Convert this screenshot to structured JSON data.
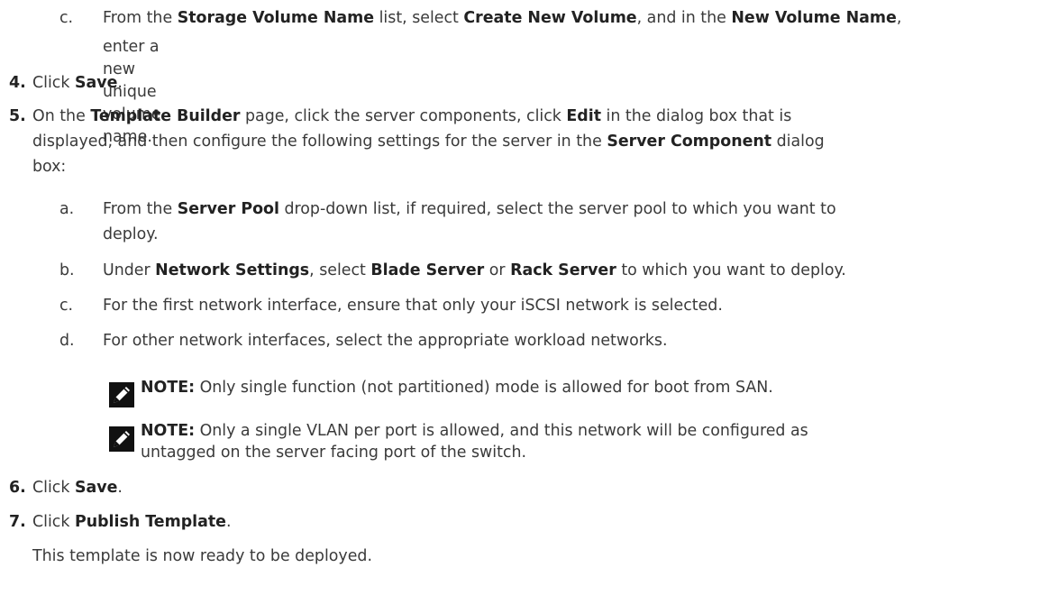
{
  "step3c": {
    "letter": "c.",
    "line1": [
      {
        "t": "From the ",
        "b": false
      },
      {
        "t": "Storage Volume Name",
        "b": true
      },
      {
        "t": " list, select ",
        "b": false
      },
      {
        "t": "Create New Volume",
        "b": true
      },
      {
        "t": ", and in the ",
        "b": false
      },
      {
        "t": "New Volume Name",
        "b": true
      },
      {
        "t": ",",
        "b": false
      }
    ],
    "line2": "enter a new unique volume name."
  },
  "step4": {
    "number": "4.",
    "parts": [
      {
        "t": "Click ",
        "b": false
      },
      {
        "t": "Save",
        "b": true
      },
      {
        "t": ".",
        "b": false
      }
    ]
  },
  "step5": {
    "number": "5.",
    "line1": [
      {
        "t": "On the ",
        "b": false
      },
      {
        "t": "Template Builder",
        "b": true
      },
      {
        "t": " page, click the server components, click ",
        "b": false
      },
      {
        "t": "Edit",
        "b": true
      },
      {
        "t": " in the dialog box that is",
        "b": false
      }
    ],
    "line2": [
      {
        "t": "displayed, and then configure the following settings for the server in the ",
        "b": false
      },
      {
        "t": "Server Component",
        "b": true
      },
      {
        "t": " dialog",
        "b": false
      }
    ],
    "line3": "box:"
  },
  "step5a": {
    "letter": "a.",
    "line1": [
      {
        "t": "From the ",
        "b": false
      },
      {
        "t": "Server Pool",
        "b": true
      },
      {
        "t": " drop-down list, if required, select the server pool to which you want to",
        "b": false
      }
    ],
    "line2": "deploy."
  },
  "step5b": {
    "letter": "b.",
    "line1": [
      {
        "t": "Under ",
        "b": false
      },
      {
        "t": "Network Settings",
        "b": true
      },
      {
        "t": ", select ",
        "b": false
      },
      {
        "t": "Blade Server",
        "b": true
      },
      {
        "t": " or ",
        "b": false
      },
      {
        "t": "Rack Server",
        "b": true
      },
      {
        "t": " to which you want to deploy.",
        "b": false
      }
    ]
  },
  "step5c": {
    "letter": "c.",
    "text": "For the first network interface, ensure that only your iSCSI network is selected."
  },
  "step5d": {
    "letter": "d.",
    "text": "For other network interfaces, select the appropriate workload networks."
  },
  "note1": {
    "icon": "pencil-note-icon",
    "label": "NOTE:",
    "text": " Only single function (not partitioned) mode is allowed for boot from SAN."
  },
  "note2": {
    "icon": "pencil-note-icon",
    "label": "NOTE:",
    "line1": " Only a single VLAN per port is allowed, and this network will be configured as",
    "line2": "untagged on the server facing port of the switch."
  },
  "step6": {
    "number": "6.",
    "parts": [
      {
        "t": "Click ",
        "b": false
      },
      {
        "t": "Save",
        "b": true
      },
      {
        "t": ".",
        "b": false
      }
    ]
  },
  "step7": {
    "number": "7.",
    "parts": [
      {
        "t": "Click ",
        "b": false
      },
      {
        "t": "Publish Template",
        "b": true
      },
      {
        "t": ".",
        "b": false
      }
    ],
    "result": "This template is now ready to be deployed."
  }
}
